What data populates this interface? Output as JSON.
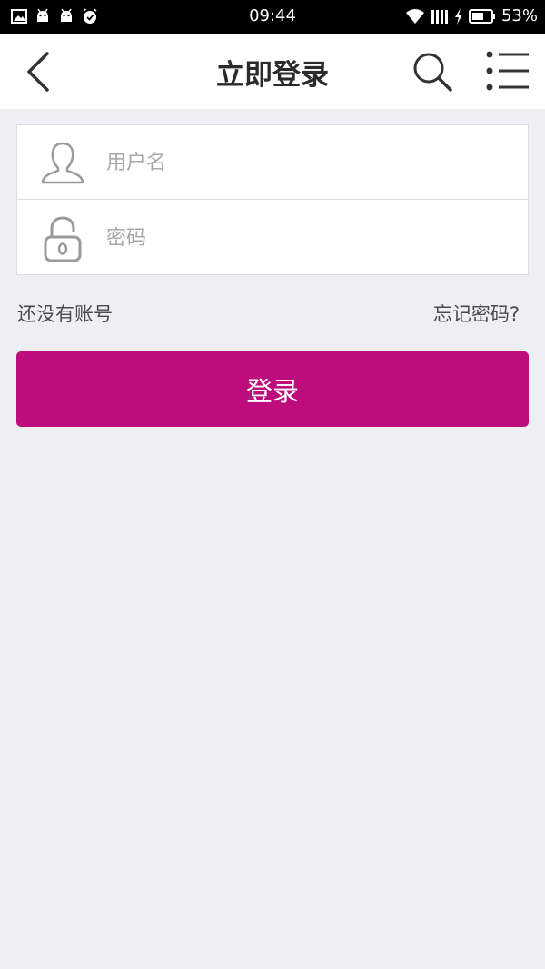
{
  "status_bar": {
    "time": "09:44",
    "battery": "53%",
    "left_icons": [
      "image-icon",
      "android-icon",
      "android-icon",
      "alarm-icon"
    ],
    "right_icons": [
      "wifi-icon",
      "signal-icon",
      "charging-icon",
      "battery-icon"
    ]
  },
  "nav": {
    "title": "立即登录",
    "back_icon": "chevron-left-icon",
    "search_icon": "search-icon",
    "menu_icon": "list-menu-icon"
  },
  "form": {
    "username_placeholder": "用户名",
    "username_value": "",
    "username_icon": "user-icon",
    "password_placeholder": "密码",
    "password_value": "",
    "password_icon": "lock-icon"
  },
  "links": {
    "register": "还没有账号",
    "forgot": "忘记密码?"
  },
  "login_button": {
    "label": "登录",
    "color": "#bd0c7c"
  },
  "colors": {
    "background": "#efeef3",
    "status_bar": "#000000",
    "nav_bar": "#ffffff"
  }
}
